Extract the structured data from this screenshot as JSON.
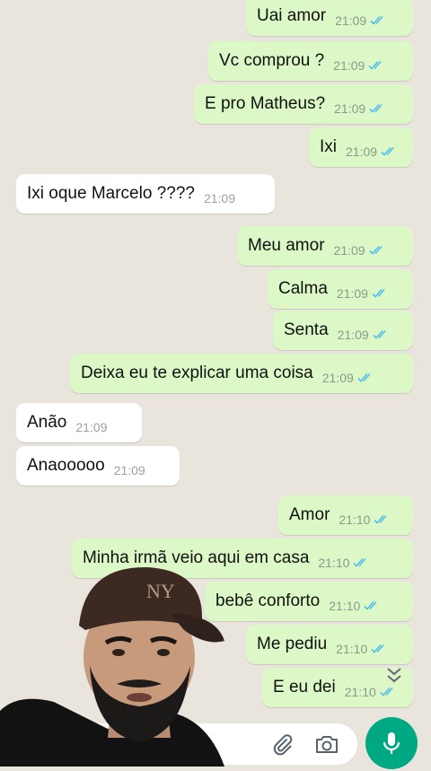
{
  "messages": [
    {
      "dir": "out",
      "text": "Uai amor",
      "time": "21:09",
      "ticks": true
    },
    {
      "dir": "out",
      "text": "Vc comprou ?",
      "time": "21:09",
      "ticks": true
    },
    {
      "dir": "out",
      "text": "E pro Matheus?",
      "time": "21:09",
      "ticks": true
    },
    {
      "dir": "out",
      "text": "Ixi",
      "time": "21:09",
      "ticks": true
    },
    {
      "dir": "in",
      "text": "Ixi oque Marcelo ????",
      "time": "21:09"
    },
    {
      "dir": "out",
      "text": "Meu amor",
      "time": "21:09",
      "ticks": true
    },
    {
      "dir": "out",
      "text": "Calma",
      "time": "21:09",
      "ticks": true
    },
    {
      "dir": "out",
      "text": "Senta",
      "time": "21:09",
      "ticks": true
    },
    {
      "dir": "out",
      "text": "Deixa eu te explicar uma coisa",
      "time": "21:09",
      "ticks": true
    },
    {
      "dir": "in",
      "text": "Anão",
      "time": "21:09"
    },
    {
      "dir": "in",
      "text": "Anaooooo",
      "time": "21:09"
    },
    {
      "dir": "out",
      "text": "Amor",
      "time": "21:10",
      "ticks": true
    },
    {
      "dir": "out",
      "text": "Minha irmã veio aqui em casa",
      "time": "21:10",
      "ticks": true
    },
    {
      "dir": "out",
      "text": "bebê conforto",
      "time": "21:10",
      "ticks": true
    },
    {
      "dir": "out",
      "text": "Me pediu",
      "time": "21:10",
      "ticks": true
    },
    {
      "dir": "out",
      "text": "E eu dei",
      "time": "21:10",
      "ticks": true
    }
  ],
  "colors": {
    "background": "#e9e5dd",
    "outgoing": "#dcf8c6",
    "incoming": "#ffffff",
    "read_ticks": "#53bdeb",
    "accent": "#00a884"
  },
  "icons": {
    "attach": "paperclip-icon",
    "camera": "camera-icon",
    "mic": "microphone-icon",
    "scroll": "double-chevron-down-icon"
  }
}
